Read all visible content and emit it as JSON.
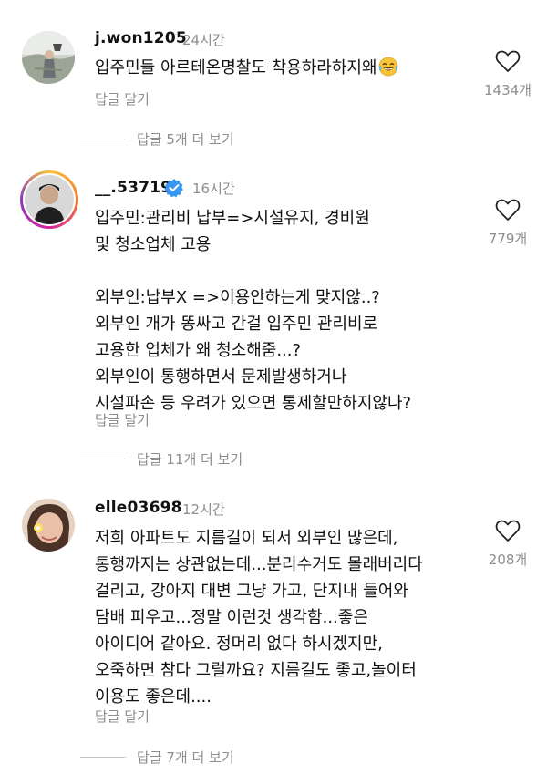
{
  "comments": [
    {
      "username": "j.won1205",
      "time": "24시간",
      "text": "입주민들 아르테온명찰도 착용하라하지왜",
      "emoji": "face-with-tears-of-joy",
      "reply_label": "답글 달기",
      "likes": "1434개",
      "more_replies": "답글 5개 더 보기"
    },
    {
      "username": "__.53719",
      "verified": true,
      "time": "16시간",
      "text": "입주민:관리비 납부=>시설유지, 경비원\n및 청소업체 고용\n\n외부인:납부X =>이용안하는게 맞지않..?\n외부인 개가 똥싸고 간걸 입주민 관리비로\n고용한 업체가 왜 청소해줌...?\n외부인이 통행하면서 문제발생하거나\n시설파손 등 우려가 있으면 통제할만하지않나?",
      "reply_label": "답글 달기",
      "likes": "779개",
      "more_replies": "답글 11개 더 보기"
    },
    {
      "username": "elle03698",
      "time": "12시간",
      "text": "저희 아파트도  지름길이 되서 외부인 많은데,\n통행까지는 상관없는데...분리수거도 몰래버리다\n걸리고, 강아지 대변 그냥 가고, 단지내 들어와\n담배 피우고...정말 이런것 생각함...좋은\n아이디어 같아요. 정머리 없다 하시겠지만,\n오죽하면 참다 그럴까요? 지름길도 좋고,놀이터\n이용도 좋은데....",
      "reply_label": "답글 달기",
      "likes": "208개",
      "more_replies": "답글 7개 더 보기"
    }
  ],
  "colors": {
    "text": "#111111",
    "muted": "#8e8e8e",
    "verified": "#3897f0"
  }
}
